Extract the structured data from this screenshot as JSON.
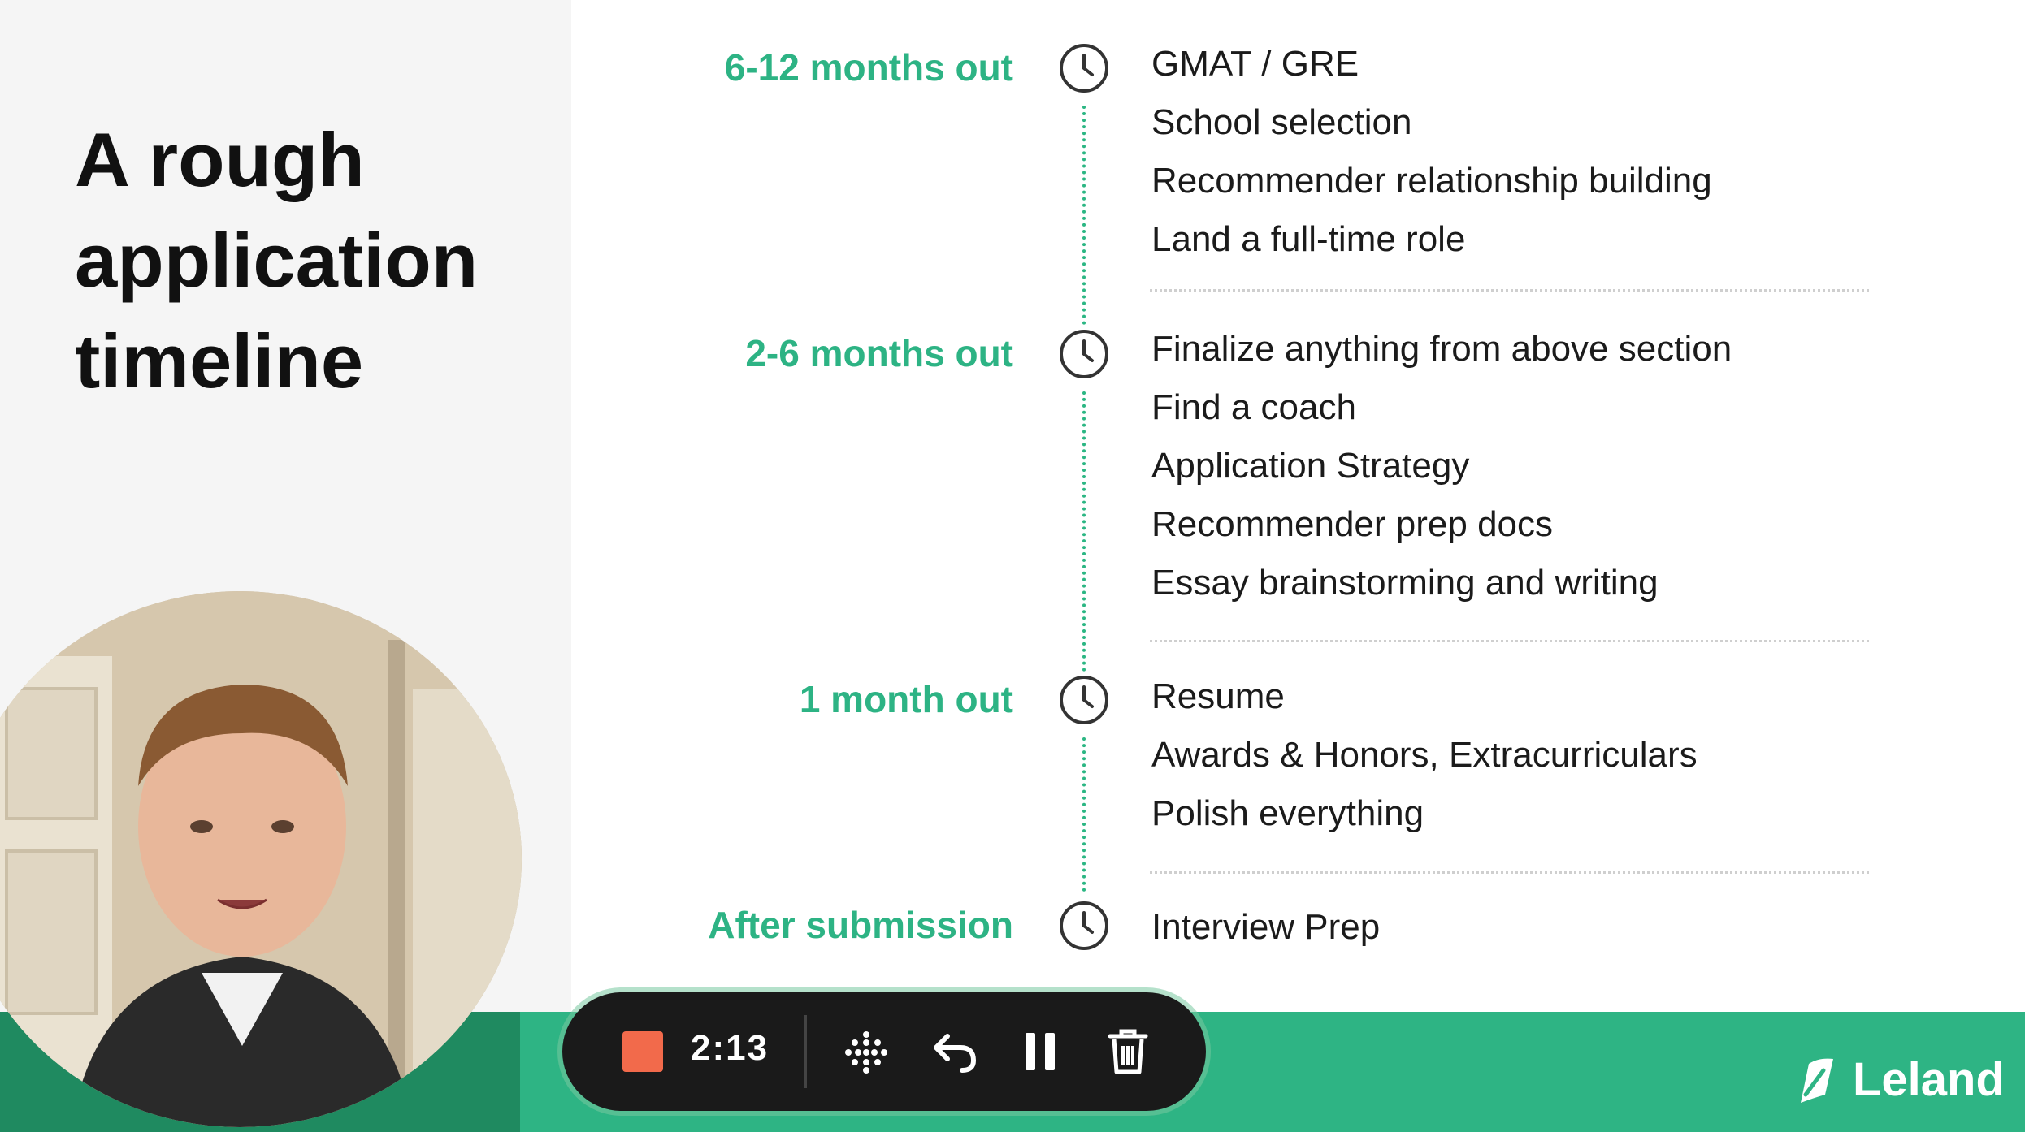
{
  "slide": {
    "title": "A rough application timeline",
    "sections": [
      {
        "period": "6-12 months out",
        "items": [
          "GMAT / GRE",
          "School selection",
          "Recommender relationship building",
          "Land a full-time role"
        ]
      },
      {
        "period": "2-6 months out",
        "items": [
          "Finalize anything from above section",
          "Find a coach",
          "Application Strategy",
          "Recommender prep docs",
          "Essay brainstorming and writing"
        ]
      },
      {
        "period": "1 month out",
        "items": [
          "Resume",
          "Awards & Honors, Extracurriculars",
          "Polish everything"
        ]
      },
      {
        "period": "After submission",
        "items": [
          "Interview Prep"
        ]
      }
    ]
  },
  "recorder": {
    "elapsed_time": "2:13",
    "icons": [
      "stop-icon",
      "grid-dots-icon",
      "undo-icon",
      "pause-icon",
      "trash-icon"
    ]
  },
  "brand": {
    "name": "Leland"
  },
  "colors": {
    "accent_green": "#2eb484",
    "period_text": "#2db384",
    "stop_button": "#f26a4b",
    "control_bar": "#1a1a1a"
  }
}
